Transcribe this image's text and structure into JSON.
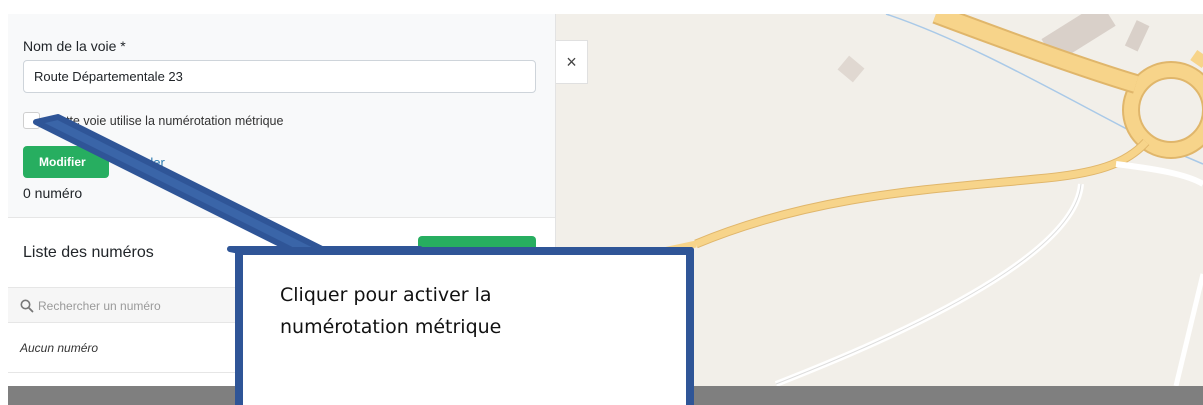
{
  "form": {
    "label": "Nom de la voie *",
    "value": "Route Départementale 23",
    "checkbox_label": "Cette voie utilise la numérotation métrique",
    "checkbox_checked": false,
    "modify_button": "Modifier",
    "cancel_link": "Annuler",
    "count": "0 numéro"
  },
  "list": {
    "title": "Liste des numéros",
    "search_placeholder": "Rechercher un numéro",
    "empty": "Aucun numéro"
  },
  "close_icon": "×",
  "callout": {
    "text": "Cliquer pour activer la numérotation métrique"
  },
  "colors": {
    "accent_green": "#27ae60",
    "annotation_blue": "#2f5597",
    "link_blue": "#2a7ab0",
    "map_background": "#f2efe9",
    "road_yellow": "#f7d48a"
  },
  "icons": [
    "search-icon",
    "close-icon",
    "checkbox-icon"
  ]
}
